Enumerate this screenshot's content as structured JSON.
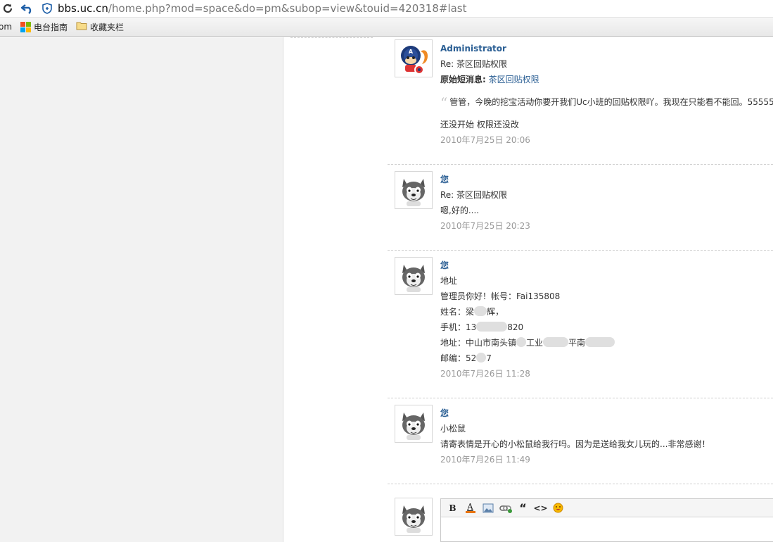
{
  "browser": {
    "url_host": "bbs.uc.cn",
    "url_path": "/home.php?mod=space&do=pm&subop=view&touid=420318#last",
    "bookmarks": [
      {
        "label": "om",
        "icon": "truncated-text"
      },
      {
        "label": "电台指南",
        "icon": "windows-logo-icon"
      },
      {
        "label": "收藏夹栏",
        "icon": "folder-icon"
      }
    ]
  },
  "messages": [
    {
      "author": "Administrator",
      "subject": "Re: 茶区回贴权限",
      "orig_label": "原始短消息:",
      "orig_link": "茶区回贴权限",
      "quote": "管管，今晚的挖宝活动你要开我们Uc小班的回贴权限吖。我现在只能看不能回。55555",
      "text": "还没开始 权限还没改",
      "time": "2010年7月25日 20:06",
      "avatar": "squirrel-captain-avatar"
    },
    {
      "author": "您",
      "subject": "Re: 茶区回贴权限",
      "text": "嗯,好的....",
      "time": "2010年7月25日 20:23",
      "avatar": "husky-avatar"
    },
    {
      "author": "您",
      "subject": "地址",
      "lines": [
        "管理员你好！帐号：Fai135808",
        "姓名：梁",
        "辉，",
        "手机：13",
        "820",
        "地址：中山市南头镇",
        "工业",
        "平南",
        "邮编：52",
        "7"
      ],
      "time": "2010年7月26日 11:28",
      "avatar": "husky-avatar"
    },
    {
      "author": "您",
      "subject": "小松鼠",
      "text": "请寄表情是开心的小松鼠给我行吗。因为是送给我女儿玩的...非常感谢！",
      "time": "2010年7月26日 11:49",
      "avatar": "husky-avatar"
    }
  ],
  "editor": {
    "tools": [
      {
        "name": "bold-button",
        "glyph": "B"
      },
      {
        "name": "font-color-button",
        "glyph": "A"
      },
      {
        "name": "image-button",
        "glyph": ""
      },
      {
        "name": "link-button",
        "glyph": ""
      },
      {
        "name": "quote-button",
        "glyph": "“"
      },
      {
        "name": "code-button",
        "glyph": "<>"
      },
      {
        "name": "smiley-button",
        "glyph": ""
      }
    ]
  }
}
